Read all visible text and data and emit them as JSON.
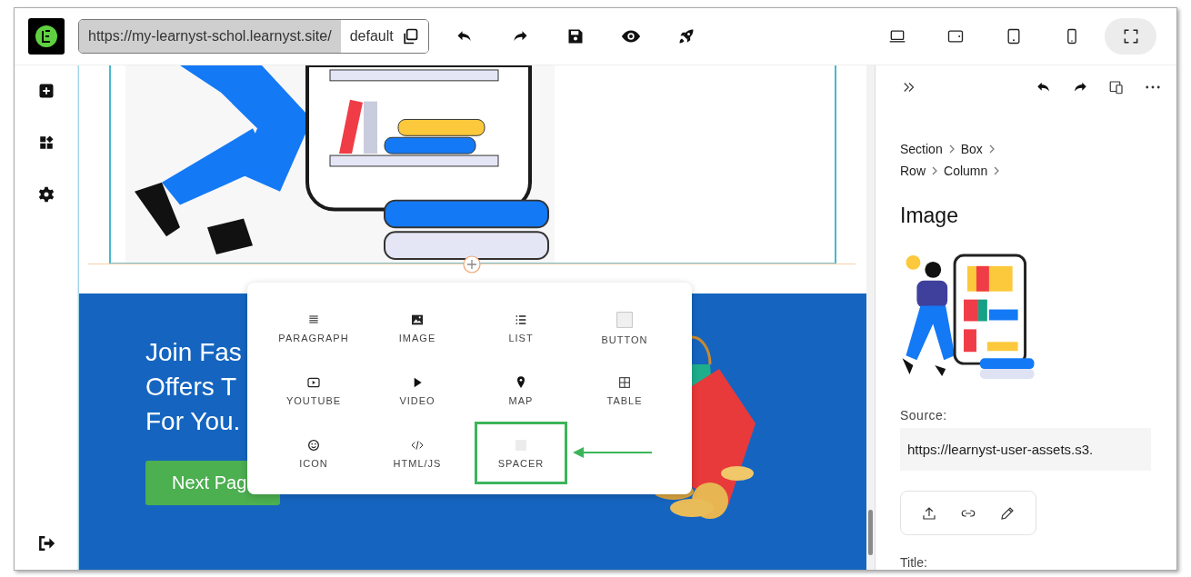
{
  "toolbar": {
    "url": "https://my-learnyst-schol.learnyst.site/",
    "version": "default",
    "devices": [
      {
        "selected": false
      },
      {
        "selected": false
      },
      {
        "selected": false
      },
      {
        "selected": false
      },
      {
        "selected": true
      }
    ]
  },
  "canvas": {
    "banner_lines": [
      "Join Fas",
      "Offers T",
      "For You."
    ],
    "button": "Next Pag"
  },
  "add_menu": {
    "items": [
      {
        "label": "PARAGRAPH",
        "selected": false
      },
      {
        "label": "IMAGE",
        "selected": false
      },
      {
        "label": "LIST",
        "selected": false
      },
      {
        "label": "BUTTON",
        "selected": false
      },
      {
        "label": "YOUTUBE",
        "selected": false
      },
      {
        "label": "VIDEO",
        "selected": false
      },
      {
        "label": "MAP",
        "selected": false
      },
      {
        "label": "TABLE",
        "selected": false
      },
      {
        "label": "ICON",
        "selected": false
      },
      {
        "label": "HTML/JS",
        "selected": false
      },
      {
        "label": "SPACER",
        "selected": true
      }
    ]
  },
  "panel": {
    "breadcrumb_rows": [
      [
        "Section",
        "Box"
      ],
      [
        "Row",
        "Column"
      ]
    ],
    "heading": "Image",
    "source_label": "Source:",
    "source_value": "https://learnyst-user-assets.s3.",
    "title_label": "Title:"
  }
}
